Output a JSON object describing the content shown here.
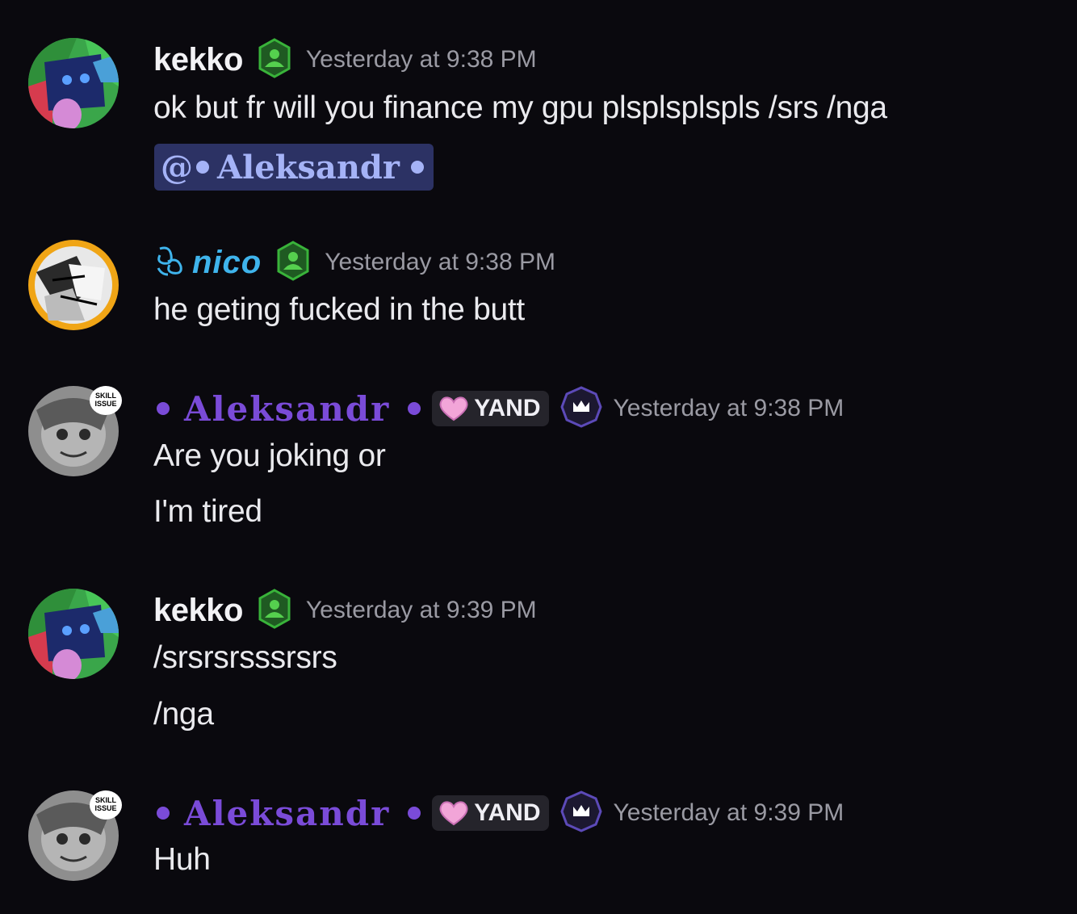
{
  "messages": [
    {
      "author": "kekko",
      "timestamp": "Yesterday at 9:38 PM",
      "lines": [
        "ok but fr will you finance my gpu plsplsplspls /srs /nga"
      ],
      "mention": "@",
      "mention_name": "Aleksandr"
    },
    {
      "author": "nico",
      "timestamp": "Yesterday at 9:38 PM",
      "lines": [
        "he geting fucked in the butt"
      ]
    },
    {
      "author": "Aleksandr",
      "tag": "YAND",
      "timestamp": "Yesterday at 9:38 PM",
      "lines": [
        "Are you joking or",
        "I'm tired"
      ]
    },
    {
      "author": "kekko",
      "timestamp": "Yesterday at 9:39 PM",
      "lines": [
        "/srsrsrsssrsrs",
        "/nga"
      ]
    },
    {
      "author": "Aleksandr",
      "tag": "YAND",
      "timestamp": "Yesterday at 9:39 PM",
      "lines": [
        "Huh"
      ]
    }
  ],
  "colors": {
    "background": "#0a090e",
    "aleksandr": "#7a4bd8",
    "nico": "#3fb4ec",
    "mention_bg": "#2c3264",
    "mention_text": "#a5b3f7",
    "timestamp": "#9a9aa3"
  },
  "icons": {
    "member_badge": "green-person-badge-icon",
    "crown_badge": "crown-badge-icon",
    "heart": "pink-heart-icon",
    "nico_prefix": "swirl-icon"
  }
}
